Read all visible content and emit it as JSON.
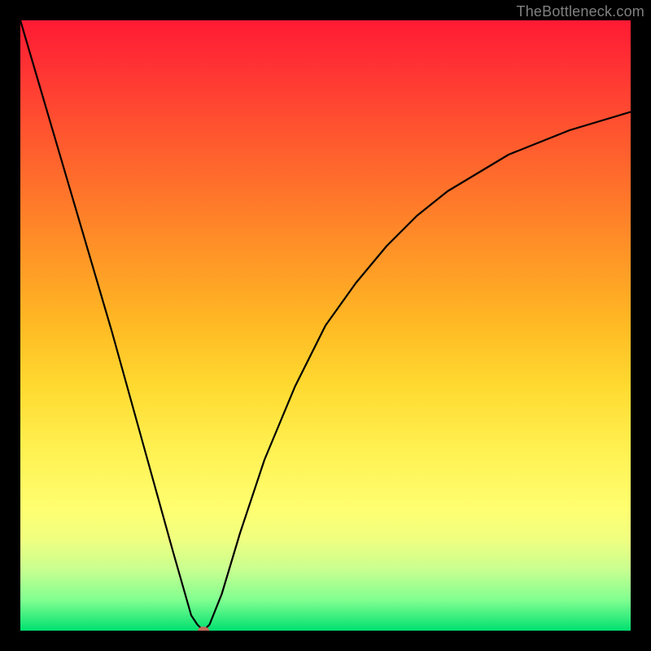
{
  "watermark": "TheBottleneck.com",
  "chart_data": {
    "type": "line",
    "title": "",
    "xlabel": "",
    "ylabel": "",
    "xlim": [
      0,
      100
    ],
    "ylim": [
      0,
      100
    ],
    "grid": false,
    "series": [
      {
        "name": "curve",
        "x": [
          0,
          5,
          10,
          15,
          20,
          25,
          28,
          29,
          30,
          31,
          33,
          36,
          40,
          45,
          50,
          55,
          60,
          65,
          70,
          75,
          80,
          85,
          90,
          95,
          100
        ],
        "values": [
          100,
          83,
          66,
          49,
          31,
          13,
          2.5,
          1,
          0,
          1,
          6,
          16,
          28,
          40,
          50,
          57,
          63,
          68,
          72,
          75,
          78,
          80,
          82,
          83.5,
          85
        ]
      }
    ],
    "marker": {
      "x": 30,
      "y": 0
    },
    "gradient_stops": [
      {
        "pos": 0,
        "color": "#ff1a33"
      },
      {
        "pos": 50,
        "color": "#ffba24"
      },
      {
        "pos": 80,
        "color": "#ffff70"
      },
      {
        "pos": 100,
        "color": "#00e070"
      }
    ]
  }
}
